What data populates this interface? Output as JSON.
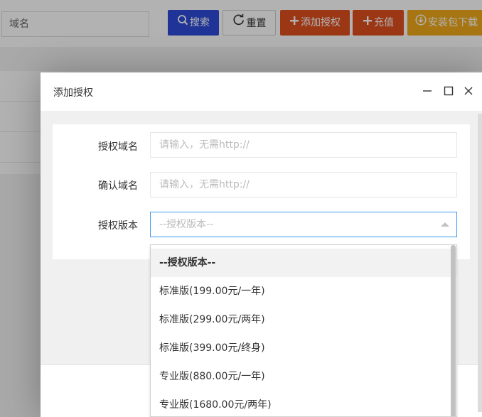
{
  "toolbar": {
    "domain_placeholder": "域名",
    "search_label": "搜索",
    "reset_label": "重置",
    "add_label": "添加授权",
    "recharge_label": "充值",
    "download_label": "安装包下载"
  },
  "modal": {
    "title": "添加授权",
    "fields": [
      {
        "label": "授权域名",
        "placeholder": "请输入，无需http://"
      },
      {
        "label": "确认域名",
        "placeholder": "请输入，无需http://"
      },
      {
        "label": "授权版本",
        "placeholder": "--授权版本--"
      }
    ]
  },
  "dropdown": {
    "options": [
      "--授权版本--",
      "标准版(199.00元/一年)",
      "标准版(299.00元/两年)",
      "标准版(399.00元/终身)",
      "专业版(880.00元/一年)",
      "专业版(1680.00元/两年)"
    ],
    "selected_index": 0
  },
  "colors": {
    "search": "#2f4bd8",
    "add": "#e0501f",
    "download": "#f0a91c",
    "focus": "#3d9cf0"
  },
  "icons": [
    "search-icon",
    "refresh-icon",
    "plus-icon",
    "download-icon",
    "minimize-icon",
    "maximize-icon",
    "close-icon",
    "caret-up-icon"
  ]
}
